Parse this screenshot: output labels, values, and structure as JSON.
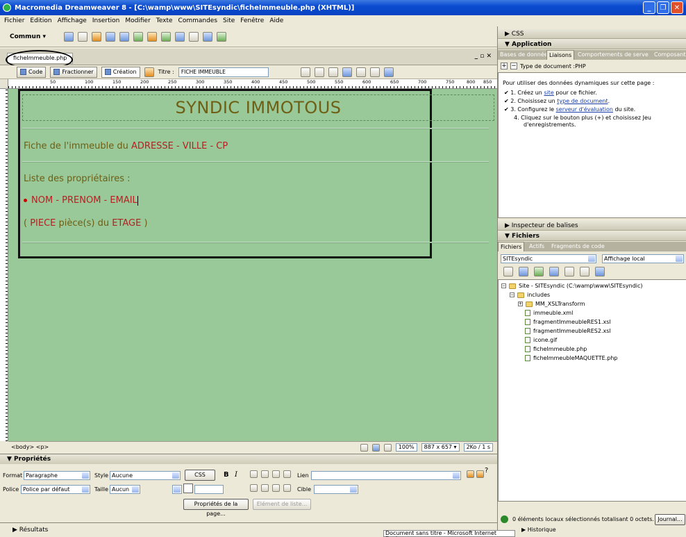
{
  "window": {
    "title": "Macromedia Dreamweaver 8 - [C:\\wamp\\www\\SITEsyndic\\ficheImmeuble.php (XHTML)]"
  },
  "menu": [
    "Fichier",
    "Edition",
    "Affichage",
    "Insertion",
    "Modifier",
    "Texte",
    "Commandes",
    "Site",
    "Fenêtre",
    "Aide"
  ],
  "insertbar": {
    "category": "Commun ▾"
  },
  "document": {
    "tab": "ficheImmeuble.php",
    "view_code": "Code",
    "view_split": "Fractionner",
    "view_design": "Création",
    "title_label": "Titre :",
    "title_value": "FICHE IMMEUBLE"
  },
  "ruler": [
    "50",
    "100",
    "150",
    "200",
    "250",
    "300",
    "350",
    "400",
    "450",
    "500",
    "550",
    "600",
    "650",
    "700",
    "750",
    "800",
    "850"
  ],
  "page": {
    "heading": "SYNDIC IMMOTOUS",
    "fiche_prefix": "Fiche de l'immeuble du ",
    "fiche_adresse": "ADRESSE",
    "sep1": " - ",
    "fiche_ville": "VILLE",
    "sep2": " - ",
    "fiche_cp": "CP",
    "liste": "Liste des propriétaires :",
    "item_nom": "NOM",
    "item_sep1": " - ",
    "item_prenom": "PRENOM",
    "item_sep2": " - ",
    "item_email": "EMAIL",
    "piece_open": "( ",
    "piece_piece": "PIECE",
    "piece_mid": " pièce(s) du ",
    "piece_etage": "ETAGE",
    "piece_close": " )"
  },
  "status": {
    "tags": "<body> <p>",
    "zoom": "100%",
    "size": "887 x 657 ▾",
    "weight": "2Ko / 1 s"
  },
  "properties": {
    "title": "▼ Propriétés",
    "format_label": "Format",
    "format_value": "Paragraphe",
    "style_label": "Style",
    "style_value": "Aucune",
    "css_btn": "CSS",
    "lien_label": "Lien",
    "police_label": "Police",
    "police_value": "Police par défaut",
    "taille_label": "Taille",
    "taille_value": "Aucun",
    "cible_label": "Cible",
    "page_props_btn": "Propriétés de la page...",
    "list_item_btn": "Elément de liste..."
  },
  "results": {
    "label": "▶ Résultats"
  },
  "panels": {
    "css": "▶ CSS",
    "application": "▼ Application",
    "app_tabs": [
      "Bases de données",
      "Liaisons",
      "Comportements de serve",
      "Composants"
    ],
    "doc_type": "Type de document :PHP",
    "intro": "Pour utiliser des données dynamiques sur cette page :",
    "step1_pre": "1.  Créez un ",
    "step1_link": "site",
    "step1_post": " pour ce fichier.",
    "step2_pre": "2.  Choisissez un ",
    "step2_link": "type de document",
    "step2_post": ".",
    "step3_pre": "3.  Configurez le ",
    "step3_link": "serveur d'évaluation",
    "step3_post": " du site.",
    "step4a": "4.  Cliquez sur le bouton plus (+) et choisissez Jeu",
    "step4b": "d'enregistrements.",
    "inspecteur": "▶ Inspecteur de balises",
    "fichiers": "▼ Fichiers",
    "files_tabs": [
      "Fichiers",
      "Actifs",
      "Fragments de code"
    ],
    "site_select": "SITEsyndic",
    "view_select": "Affichage local",
    "tree": [
      "Site - SITEsyndic (C:\\wamp\\www\\SITEsyndic)",
      "includes",
      "MM_XSLTransform",
      "immeuble.xml",
      "fragmentImmeubleRES1.xsl",
      "fragmentImmeubleRES2.xsl",
      "icone.gif",
      "ficheImmeuble.php",
      "ficheImmeubleMAQUETTE.php"
    ],
    "files_status": "0 éléments locaux sélectionnés totalisant 0 octets.",
    "journal_btn": "Journal...",
    "historique": "▶ Historique"
  },
  "tooltip": "Document sans titre - Microsoft Internet Explorer"
}
